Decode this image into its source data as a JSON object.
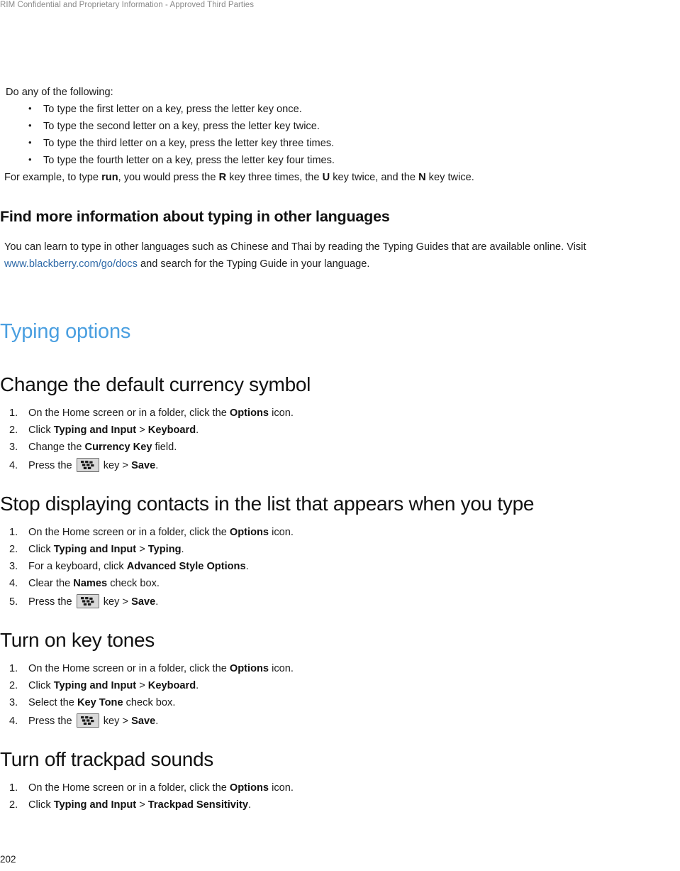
{
  "header": {
    "text": "RIM Confidential and Proprietary Information - Approved Third Parties"
  },
  "footer": {
    "page_number": "202"
  },
  "colors": {
    "section_heading_blue": "#4a9fe0",
    "link_blue": "#2f6aa8",
    "body_text": "#1a1a1a",
    "header_gray": "#8a8a8a",
    "key_glyph_fill": "#d9d9d9",
    "key_glyph_border": "#6e6e6e"
  },
  "intro": {
    "lead": "Do any of the following:",
    "bullets": [
      "To type the first letter on a key, press the letter key once.",
      "To type the second letter on a key, press the letter key twice.",
      "To type the third letter on a key, press the letter key three times.",
      "To type the fourth letter on a key, press the letter key four times."
    ],
    "example": {
      "p1": "For example, to type ",
      "b1": "run",
      "p2": ", you would press the ",
      "b2": "R",
      "p3": " key three times, the ",
      "b3": "U",
      "p4": " key twice, and the ",
      "b4": "N",
      "p5": " key twice."
    }
  },
  "find_more": {
    "heading": "Find more information about typing in other languages",
    "body_before_link": "You can learn to type in other languages such as Chinese and Thai by reading the Typing Guides that are available online. Visit ",
    "link_text": "www.blackberry.com/go/docs",
    "body_after_link": " and search for the Typing Guide in your language."
  },
  "typing_options": {
    "heading": "Typing options",
    "sections": [
      {
        "heading": "Change the default currency symbol",
        "steps": [
          {
            "pre": "On the Home screen or in a folder, click the ",
            "bold": "Options",
            "post": " icon."
          },
          {
            "pre": "Click ",
            "bold": "Typing and Input",
            "mid": " > ",
            "bold2": "Keyboard",
            "post": "."
          },
          {
            "pre": "Change the ",
            "bold": "Currency Key",
            "post": " field."
          },
          {
            "pre": "Press the ",
            "key": "blackberry-menu-key",
            "mid": " key > ",
            "bold2": "Save",
            "post": "."
          }
        ]
      },
      {
        "heading": "Stop displaying contacts in the list that appears when you type",
        "steps": [
          {
            "pre": "On the Home screen or in a folder, click the ",
            "bold": "Options",
            "post": " icon."
          },
          {
            "pre": "Click ",
            "bold": "Typing and Input",
            "mid": " > ",
            "bold2": "Typing",
            "post": "."
          },
          {
            "pre": "For a keyboard, click ",
            "bold": "Advanced Style Options",
            "post": "."
          },
          {
            "pre": "Clear the ",
            "bold": "Names",
            "post": " check box."
          },
          {
            "pre": "Press the ",
            "key": "blackberry-menu-key",
            "mid": " key > ",
            "bold2": "Save",
            "post": "."
          }
        ]
      },
      {
        "heading": "Turn on key tones",
        "steps": [
          {
            "pre": "On the Home screen or in a folder, click the ",
            "bold": "Options",
            "post": " icon."
          },
          {
            "pre": "Click ",
            "bold": "Typing and Input",
            "mid": " > ",
            "bold2": "Keyboard",
            "post": "."
          },
          {
            "pre": "Select the ",
            "bold": "Key Tone",
            "post": " check box."
          },
          {
            "pre": "Press the ",
            "key": "blackberry-menu-key",
            "mid": " key > ",
            "bold2": "Save",
            "post": "."
          }
        ]
      },
      {
        "heading": "Turn off trackpad sounds",
        "steps": [
          {
            "pre": "On the Home screen or in a folder, click the ",
            "bold": "Options",
            "post": " icon."
          },
          {
            "pre": "Click ",
            "bold": "Typing and Input",
            "mid": " > ",
            "bold2": "Trackpad Sensitivity",
            "post": "."
          }
        ]
      }
    ]
  }
}
